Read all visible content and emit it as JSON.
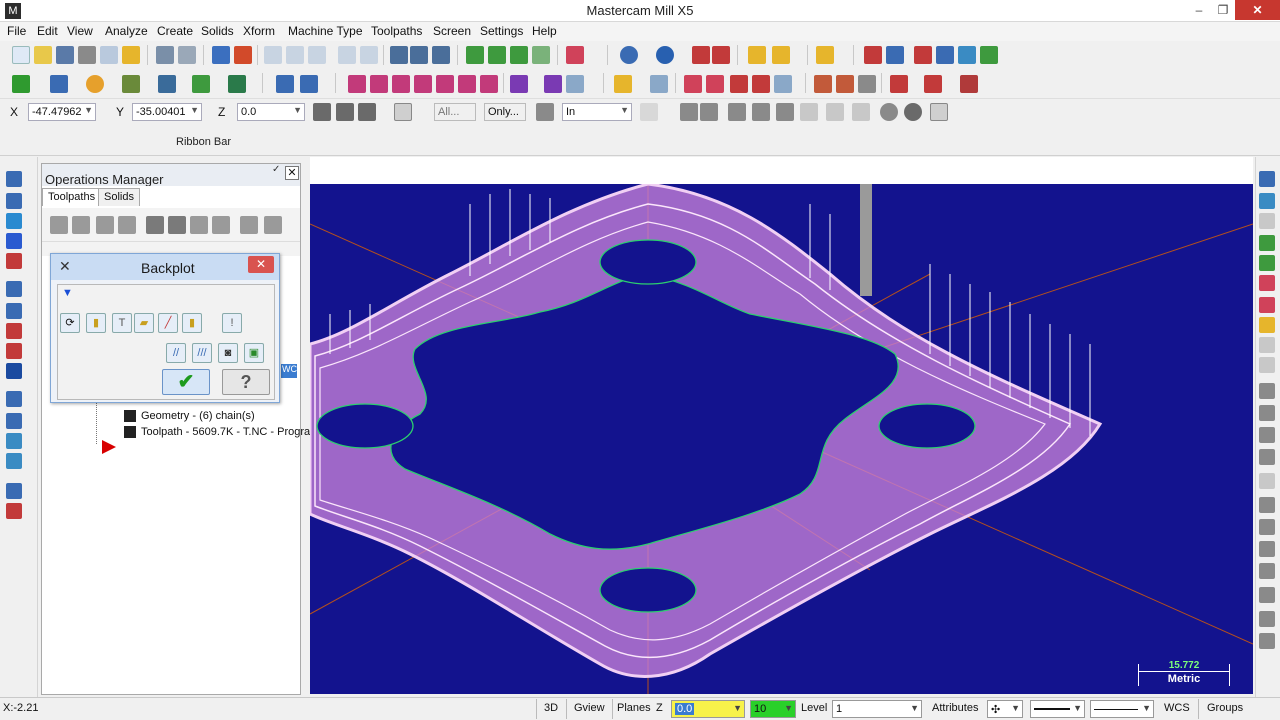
{
  "window": {
    "title": "Mastercam Mill X5",
    "minimize": "–",
    "maximize": "❐",
    "close": "✕"
  },
  "menu": [
    "File",
    "Edit",
    "View",
    "Analyze",
    "Create",
    "Solids",
    "Xform",
    "Machine Type",
    "Toolpaths",
    "Screen",
    "Settings",
    "Help"
  ],
  "coords": {
    "x_label": "X",
    "x_value": "-47.47962",
    "y_label": "Y",
    "y_value": "-35.00401",
    "z_label": "Z",
    "z_value": "0.0",
    "all_label": "All...",
    "only_label": "Only...",
    "units_value": "In"
  },
  "ribbon_bar_label": "Ribbon Bar",
  "operations_manager": {
    "title": "Operations Manager",
    "pin": "✓",
    "close": "✕",
    "tabs": [
      "Toolpaths",
      "Solids"
    ],
    "tree": {
      "geometry": "Geometry - (6) chain(s)",
      "toolpath": "Toolpath - 5609.7K - T.NC - Progra"
    },
    "wcs_tag": "WC"
  },
  "backplot": {
    "title": "Backplot",
    "close": "✕",
    "expand": "▼",
    "ok": "✔",
    "help": "?"
  },
  "viewport": {
    "scale_value": "15.772",
    "scale_unit": "Metric",
    "colors": {
      "background": "#13138e",
      "toolpath": "#e28ae6",
      "contour": "#2ccf6f",
      "rapid": "#ffffff",
      "axes": "#b5501c"
    }
  },
  "statusbar": {
    "cursor": "X:-2.21",
    "view_3d": "3D",
    "gview": "Gview",
    "planes": "Planes",
    "z_label": "Z",
    "z_value": "0.0",
    "color_value": "10",
    "level_label": "Level",
    "level_value": "1",
    "attributes": "Attributes",
    "wcs": "WCS",
    "groups": "Groups"
  }
}
